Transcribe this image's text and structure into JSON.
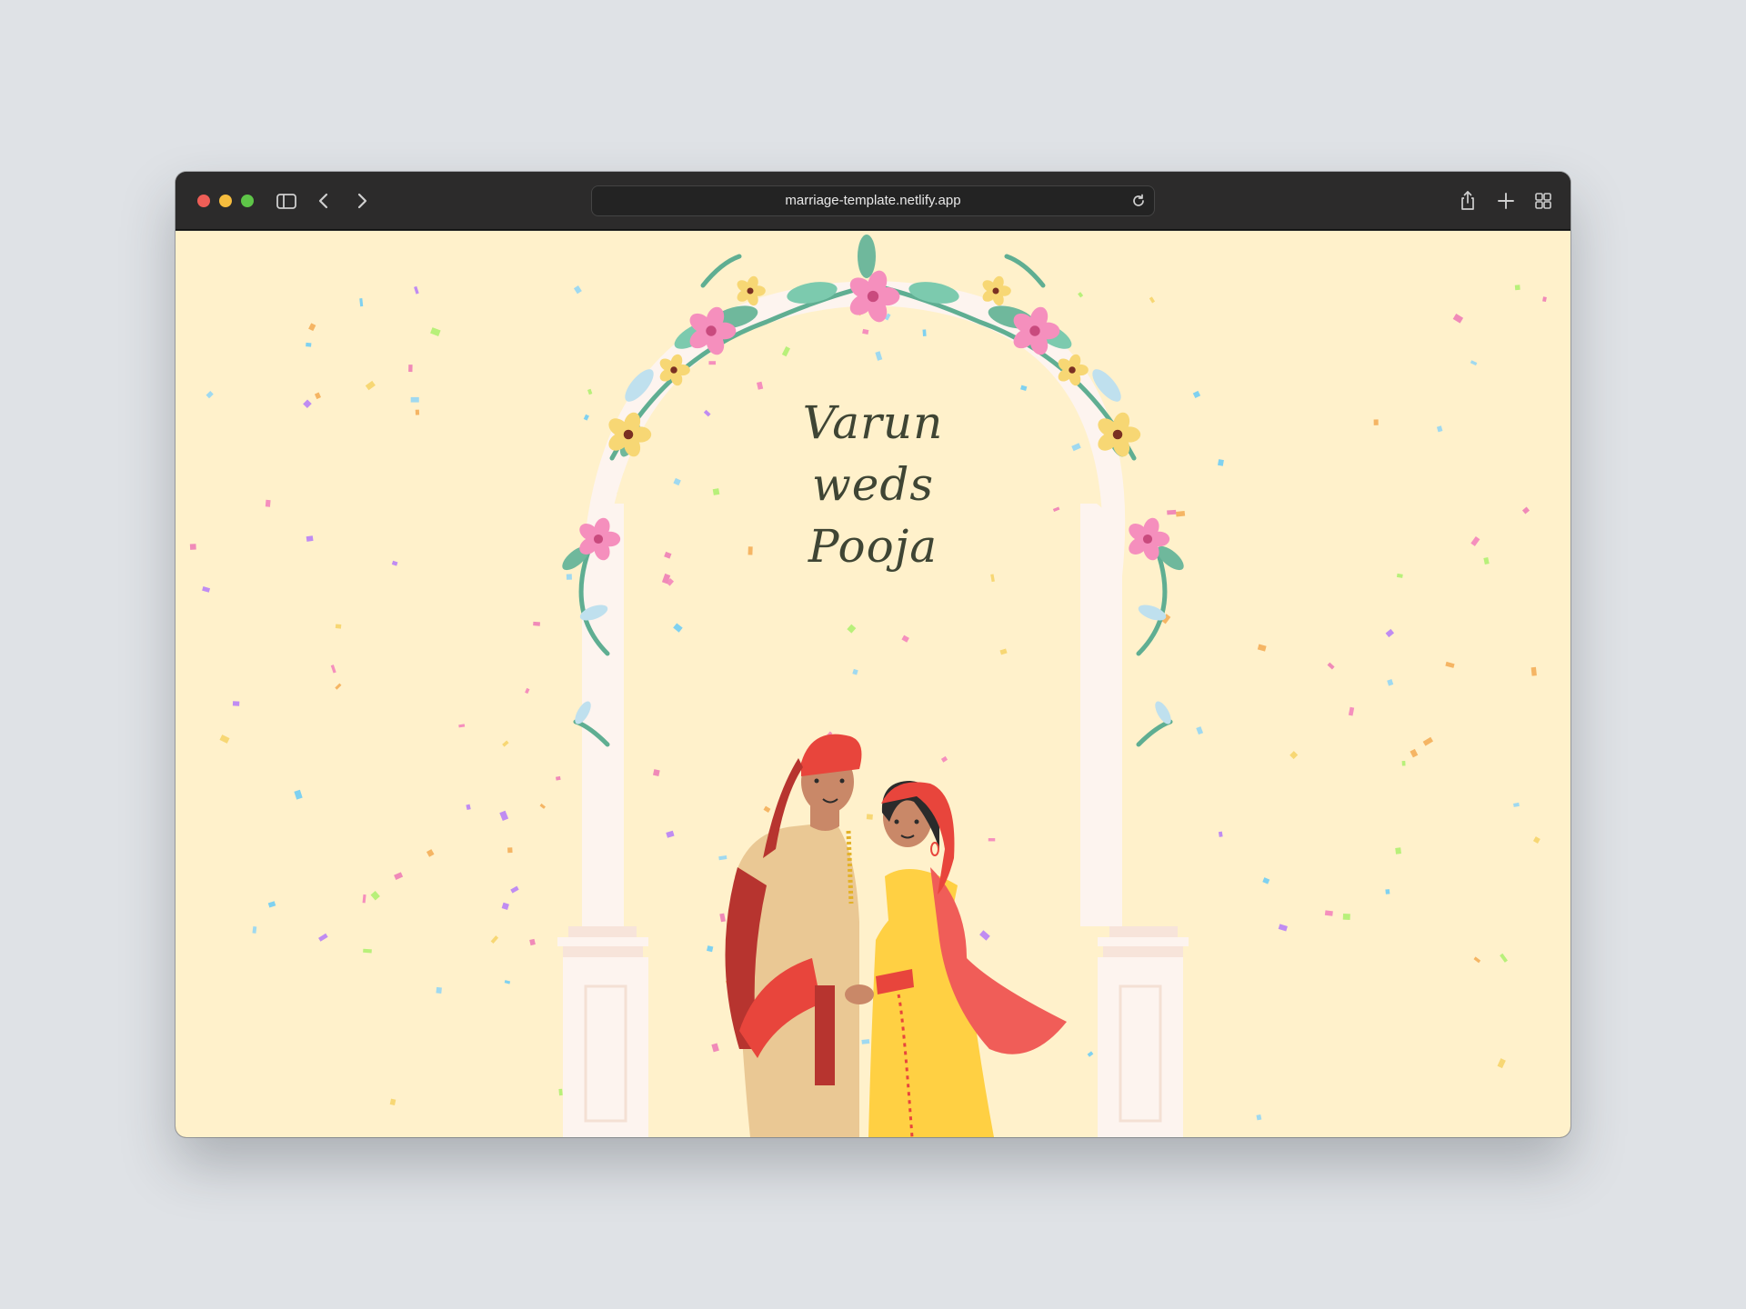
{
  "browser": {
    "url": "marriage-template.netlify.app",
    "icons": [
      "sidebar-icon",
      "back-icon",
      "forward-icon",
      "reload-icon",
      "share-icon",
      "new-tab-icon",
      "tab-overview-icon"
    ]
  },
  "page": {
    "title_lines": [
      "Varun",
      "weds",
      "Pooja"
    ],
    "colors": {
      "background": "#fff1cb",
      "title": "#3f4534",
      "pillar": "#fdf4ef",
      "leaf": "#6fb89c",
      "flower_pink": "#f58fbd",
      "flower_yellow": "#f7d774",
      "turban_red": "#e8453c",
      "dress_yellow": "#ffd043",
      "dupatta_red": "#f05d58",
      "sherwani": "#eac894"
    }
  }
}
